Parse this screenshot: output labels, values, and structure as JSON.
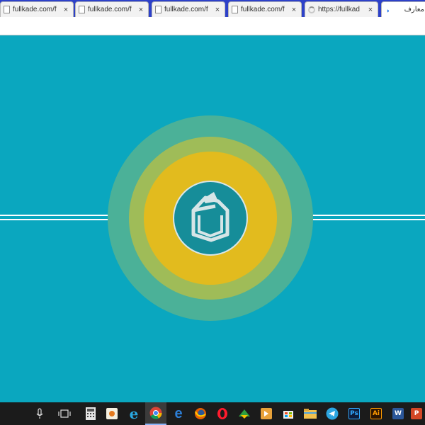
{
  "browser": {
    "tabs": [
      {
        "title": "fullkade.com/f",
        "state": "background"
      },
      {
        "title": "fullkade.com/f",
        "state": "background"
      },
      {
        "title": "fullkade.com/f",
        "state": "background"
      },
      {
        "title": "fullkade.com/f",
        "state": "background"
      },
      {
        "title": "https://fullkad",
        "state": "loading"
      },
      {
        "title": "معارف",
        "state": "active"
      }
    ],
    "close_glyph": "×"
  },
  "page": {
    "background_color": "#0aa7bf",
    "ring_colors": [
      "#4bb198",
      "#9fbc58",
      "#e2bb1e"
    ],
    "logo_color": "#168d99"
  },
  "taskbar": {
    "items": [
      {
        "name": "microphone-icon"
      },
      {
        "name": "task-view-icon"
      },
      {
        "name": "calculator-icon"
      },
      {
        "name": "media-player-icon"
      },
      {
        "name": "internet-explorer-icon"
      },
      {
        "name": "chrome-icon",
        "active": true
      },
      {
        "name": "edge-icon"
      },
      {
        "name": "firefox-icon"
      },
      {
        "name": "opera-icon"
      },
      {
        "name": "network-app-icon"
      },
      {
        "name": "video-player-icon"
      },
      {
        "name": "store-icon"
      },
      {
        "name": "file-explorer-icon"
      },
      {
        "name": "telegram-icon"
      },
      {
        "name": "photoshop-icon",
        "label": "Ps"
      },
      {
        "name": "illustrator-icon",
        "label": "Ai"
      },
      {
        "name": "word-icon",
        "label": "W"
      },
      {
        "name": "powerpoint-icon",
        "label": "P"
      }
    ]
  }
}
